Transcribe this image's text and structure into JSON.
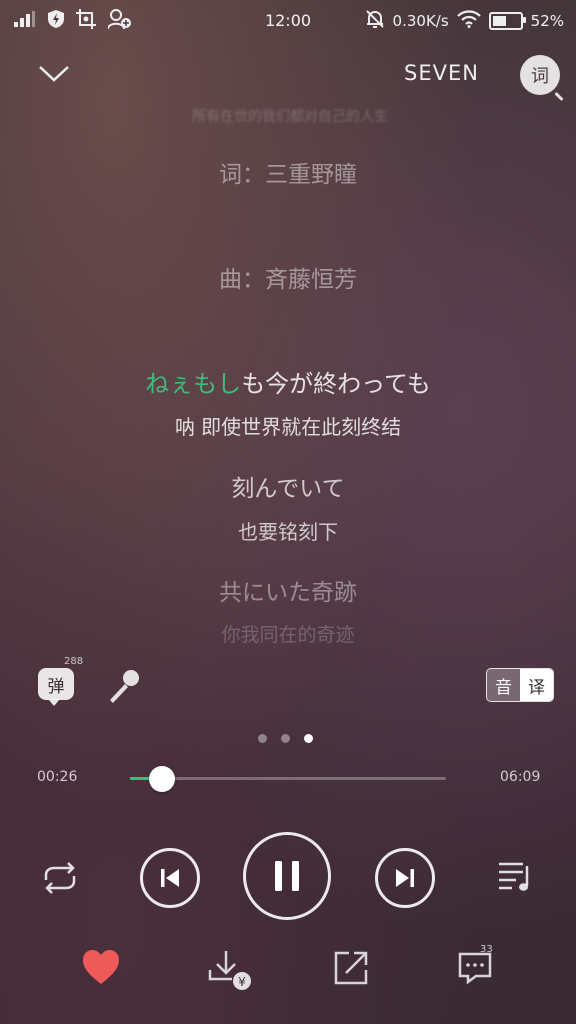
{
  "status_bar": {
    "time": "12:00",
    "net_speed": "0.30K/s",
    "battery": "52%",
    "battery_level": 0.52
  },
  "header": {
    "song_title": "SEVEN",
    "lyrics_button": "词"
  },
  "lyrics": {
    "faded_top": "所有在世的我们都对自己的人生",
    "lyricist": "词：三重野瞳",
    "composer": "曲：斉藤恒芳",
    "current_sung": "ねぇもし",
    "current_rest": "も今が終わっても",
    "current_translation": "呐 即使世界就在此刻终结",
    "next_line": "刻んでいて",
    "next_translation": "也要铭刻下",
    "third_line": "共にいた奇跡",
    "third_translation": "你我同在的奇迹"
  },
  "tools": {
    "danmu_label": "弹",
    "danmu_count": "288",
    "toggle_yin": "音",
    "toggle_yi": "译"
  },
  "pager": {
    "count": 3,
    "active": 2
  },
  "progress": {
    "elapsed": "00:26",
    "total": "06:09",
    "fraction": 0.07
  },
  "bottom": {
    "comment_count": "33"
  },
  "colors": {
    "accent": "#3dbd7a",
    "heart": "#ee5a5a"
  }
}
